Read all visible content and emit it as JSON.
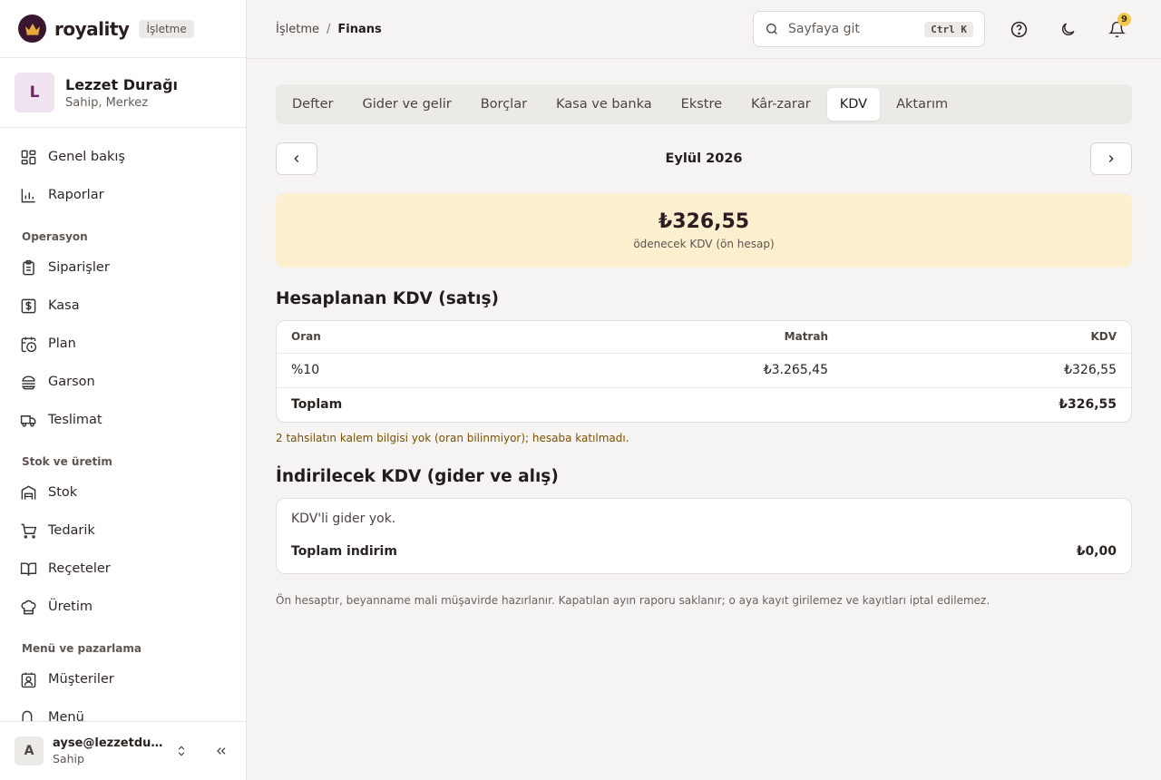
{
  "brand": {
    "name": "royality",
    "badge": "İşletme"
  },
  "business": {
    "initial": "L",
    "name": "Lezzet Durağı",
    "role": "Sahip, Merkez"
  },
  "nav": {
    "top": [
      {
        "label": "Genel bakış",
        "icon": "grid-icon"
      },
      {
        "label": "Raporlar",
        "icon": "bar-chart-icon"
      }
    ],
    "sections": [
      {
        "title": "Operasyon",
        "items": [
          {
            "label": "Siparişler",
            "icon": "clipboard-icon"
          },
          {
            "label": "Kasa",
            "icon": "dollar-icon"
          },
          {
            "label": "Plan",
            "icon": "calendar-clock-icon"
          },
          {
            "label": "Garson",
            "icon": "burger-icon"
          },
          {
            "label": "Teslimat",
            "icon": "truck-icon"
          }
        ]
      },
      {
        "title": "Stok ve üretim",
        "items": [
          {
            "label": "Stok",
            "icon": "warehouse-icon"
          },
          {
            "label": "Tedarik",
            "icon": "cart-icon"
          },
          {
            "label": "Reçeteler",
            "icon": "book-icon"
          },
          {
            "label": "Üretim",
            "icon": "chef-hat-icon"
          }
        ]
      },
      {
        "title": "Menü ve pazarlama",
        "items": [
          {
            "label": "Müşteriler",
            "icon": "contact-icon"
          },
          {
            "label": "Menü",
            "icon": "menu-icon"
          }
        ]
      }
    ]
  },
  "user": {
    "initial": "A",
    "email": "ayse@lezzetduragi.com",
    "role": "Sahip"
  },
  "breadcrumb": {
    "parent": "İşletme",
    "sep": "/",
    "current": "Finans"
  },
  "search": {
    "placeholder": "Sayfaya git",
    "shortcut": "Ctrl K"
  },
  "notifications": {
    "count": "9"
  },
  "tabs": [
    {
      "label": "Defter",
      "active": false
    },
    {
      "label": "Gider ve gelir",
      "active": false
    },
    {
      "label": "Borçlar",
      "active": false
    },
    {
      "label": "Kasa ve banka",
      "active": false
    },
    {
      "label": "Ekstre",
      "active": false
    },
    {
      "label": "Kâr-zarar",
      "active": false
    },
    {
      "label": "KDV",
      "active": true
    },
    {
      "label": "Aktarım",
      "active": false
    }
  ],
  "period": {
    "label": "Eylül 2026"
  },
  "summary": {
    "amount": "₺326,55",
    "caption": "ödenecek KDV (ön hesap)",
    "bg_color": "#fcefcf"
  },
  "sales_vat": {
    "title": "Hesaplanan KDV (satış)",
    "columns": {
      "rate": "Oran",
      "base": "Matrah",
      "vat": "KDV"
    },
    "rows": [
      {
        "rate": "%10",
        "base": "₺3.265,45",
        "vat": "₺326,55"
      }
    ],
    "total": {
      "label": "Toplam",
      "base": "",
      "vat": "₺326,55"
    },
    "note": "2 tahsilatın kalem bilgisi yok (oran bilinmiyor); hesaba katılmadı."
  },
  "deductible_vat": {
    "title": "İndirilecek KDV (gider ve alış)",
    "empty": "KDV'li gider yok.",
    "total_label": "Toplam indirim",
    "total_value": "₺0,00"
  },
  "footnote": "Ön hesaptır, beyanname mali müşavirde hazırlanır. Kapatılan ayın raporu saklanır; o aya kayıt girilemez ve kayıtları iptal edilemez."
}
